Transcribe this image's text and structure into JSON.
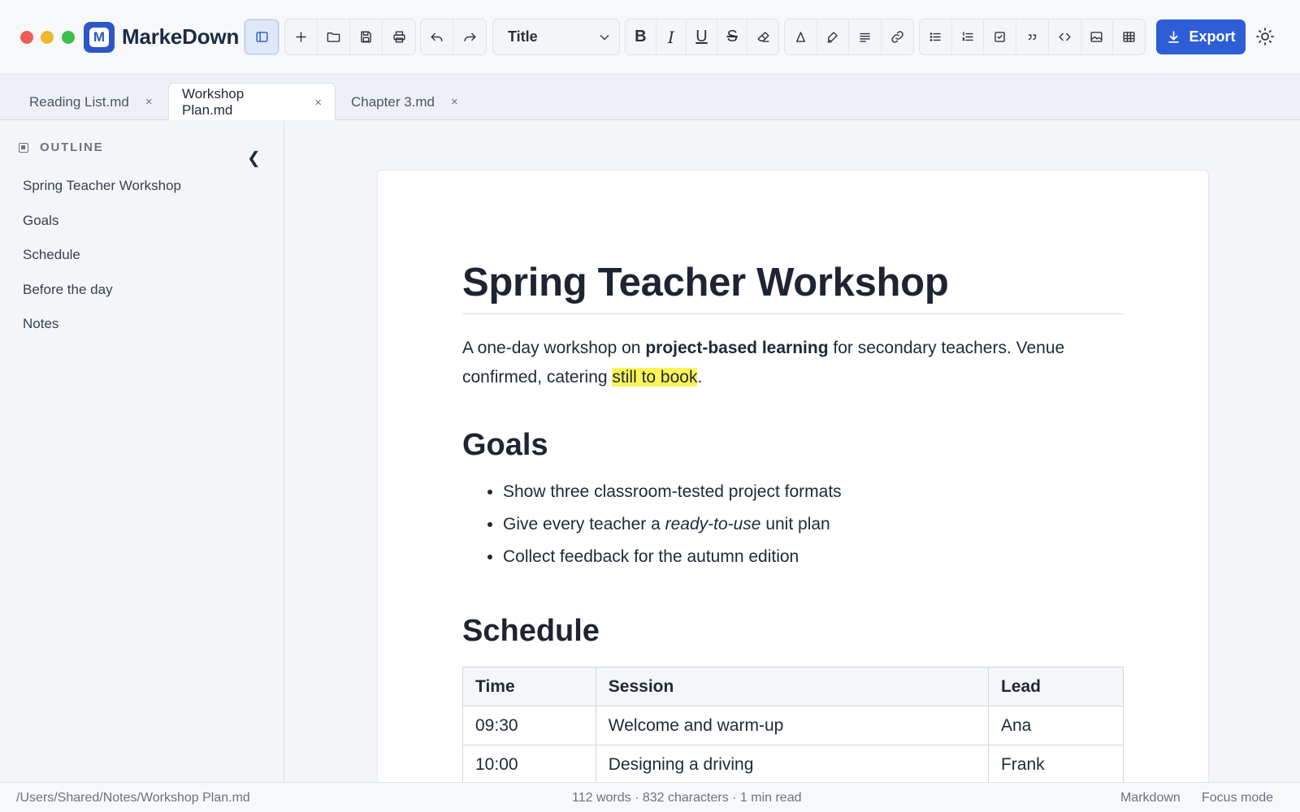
{
  "app": {
    "name": "MarkeDown",
    "logo_letter": "M"
  },
  "toolbar": {
    "style_select": "Title",
    "export_label": "Export",
    "bold_label": "B",
    "italic_label": "I",
    "underline_label": "U",
    "strike_label": "S"
  },
  "tabs": [
    {
      "label": "Reading List.md",
      "close": "×"
    },
    {
      "label": "Workshop Plan.md",
      "close": "×",
      "active": true
    },
    {
      "label": "Chapter 3.md",
      "close": "×"
    }
  ],
  "sidebar": {
    "title": "OUTLINE",
    "collapse": "❮",
    "items": [
      "Spring Teacher Workshop",
      "Goals",
      "Schedule",
      "Before the day",
      "Notes"
    ]
  },
  "doc": {
    "title": "Spring Teacher Workshop",
    "intro": {
      "p1": "A one-day workshop on ",
      "bold": "project-based learning",
      "p2": " for secondary teachers. Venue confirmed, catering ",
      "highlight": "still to book",
      "p3": "."
    },
    "goals_heading": "Goals",
    "goals": [
      {
        "pre": "Show three classroom-tested project formats",
        "em": "",
        "post": ""
      },
      {
        "pre": "Give every teacher a ",
        "em": "ready-to-use",
        "post": " unit plan"
      },
      {
        "pre": "Collect feedback for the autumn edition",
        "em": "",
        "post": ""
      }
    ],
    "schedule_heading": "Schedule",
    "table": {
      "headers": [
        "Time",
        "Session",
        "Lead"
      ],
      "rows": [
        [
          "09:30",
          "Welcome and warm-up",
          "Ana"
        ],
        [
          "10:00",
          "Designing a driving",
          "Frank"
        ]
      ]
    }
  },
  "status": {
    "path": "/Users/Shared/Notes/Workshop Plan.md",
    "stats": "112 words · 832 characters · 1 min read",
    "mode": "Markdown",
    "focus": "Focus mode"
  },
  "colors": {
    "accent": "#2d5ed6",
    "highlight": "#fbf457",
    "traffic_red": "#ee5e57",
    "traffic_yellow": "#f2b730",
    "traffic_green": "#3cbf4a"
  }
}
